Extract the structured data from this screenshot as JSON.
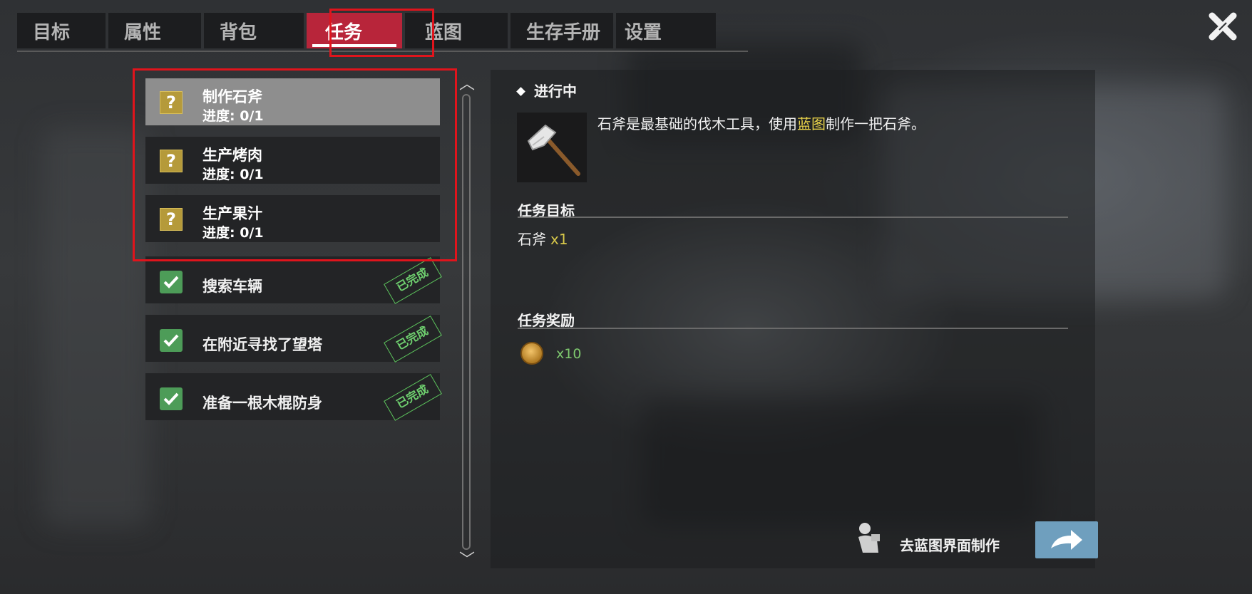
{
  "tabs": [
    {
      "label": "目标",
      "active": false
    },
    {
      "label": "属性",
      "active": false
    },
    {
      "label": "背包",
      "active": false
    },
    {
      "label": "任务",
      "active": true
    },
    {
      "label": "蓝图",
      "active": false
    },
    {
      "label": "生存手册",
      "active": false
    },
    {
      "label": "设置",
      "active": false
    }
  ],
  "quests": [
    {
      "title": "制作石斧",
      "progress": "进度: 0/1",
      "status": "active",
      "selected": true
    },
    {
      "title": "生产烤肉",
      "progress": "进度: 0/1",
      "status": "active"
    },
    {
      "title": "生产果汁",
      "progress": "进度: 0/1",
      "status": "active"
    },
    {
      "title": "搜索车辆",
      "status": "done",
      "stamp": "已完成"
    },
    {
      "title": "在附近寻找了望塔",
      "status": "done",
      "stamp": "已完成"
    },
    {
      "title": "准备一根木棍防身",
      "status": "done",
      "stamp": "已完成"
    }
  ],
  "detail": {
    "status": "进行中",
    "item_icon": "stone-axe-icon",
    "description_parts": [
      "石斧是最基础的伐木工具，使用",
      "蓝图",
      "制作一把石斧。"
    ],
    "goal_heading": "任务目标",
    "goal_item": "石斧",
    "goal_qty": "x1",
    "reward_heading": "任务奖励",
    "reward_icon": "coin-icon",
    "reward_qty": "x10",
    "craft_label": "去蓝图界面制作"
  },
  "colors": {
    "active_tab": "#b8253a",
    "highlight_box": "#e0141c",
    "quest_icon": "#b59a3a",
    "check_icon": "#4d9c58",
    "done_stamp": "#5cc35c",
    "blueprint_link": "#e8d24a",
    "craft_button": "#6f9fbe"
  }
}
